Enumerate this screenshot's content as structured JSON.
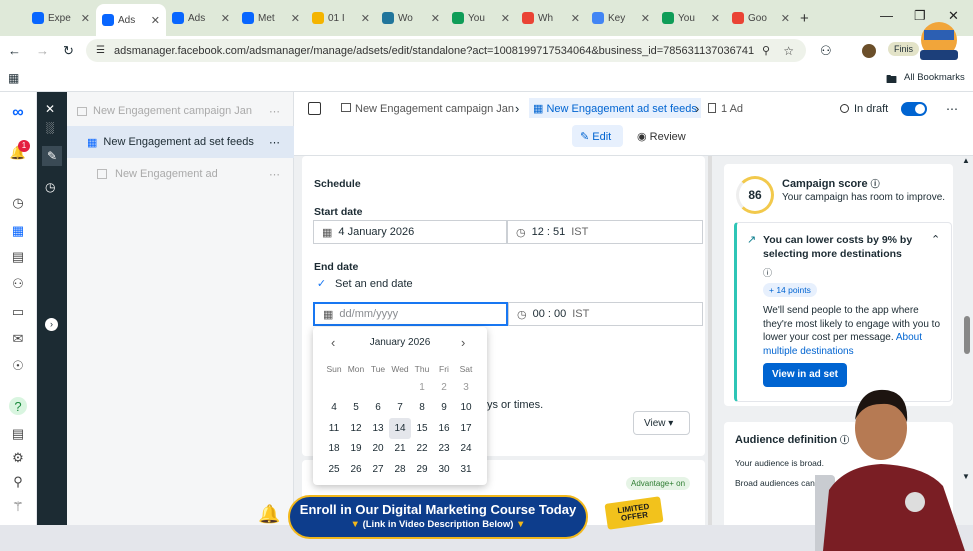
{
  "browser": {
    "tabs": [
      {
        "label": "Expe",
        "icon": "meta-icon"
      },
      {
        "label": "Ads",
        "icon": "meta-icon",
        "active": true
      },
      {
        "label": "Ads",
        "icon": "meta-icon"
      },
      {
        "label": "Met",
        "icon": "meta-icon"
      },
      {
        "label": "01 I",
        "icon": "drive-icon"
      },
      {
        "label": "Wo",
        "icon": "wordpress-icon"
      },
      {
        "label": "You",
        "icon": "sheets-icon"
      },
      {
        "label": "Wh",
        "icon": "google-icon"
      },
      {
        "label": "Key",
        "icon": "ads-icon"
      },
      {
        "label": "You",
        "icon": "sheets-icon"
      },
      {
        "label": "Goo",
        "icon": "google-icon"
      }
    ],
    "new_tab": "+",
    "url": "adsmanager.facebook.com/adsmanager/manage/adsets/edit/standalone?act=1008199717534064&business_id=785631137036741...",
    "profile_label": "Finis",
    "all_bookmarks": "All Bookmarks"
  },
  "notification_count": "1",
  "tree": {
    "campaign": "New Engagement campaign Jan",
    "adset": "New Engagement ad set feeds",
    "ad": "New Engagement ad"
  },
  "breadcrumb": {
    "campaign": "New Engagement campaign Jan",
    "adset": "New Engagement ad set feeds",
    "ad": "1 Ad",
    "status": "In draft"
  },
  "modes": {
    "edit": "Edit",
    "review": "Review"
  },
  "schedule": {
    "heading": "Schedule",
    "start_label": "Start date",
    "start_date": "4 January 2026",
    "start_time": "12 : 51",
    "tz": "IST",
    "end_label": "End date",
    "set_end": "Set an end date",
    "end_placeholder": "dd/mm/yyyy",
    "end_time": "00 : 00",
    "behind_text": "ys or times.",
    "view_btn": "View"
  },
  "calendar": {
    "month": "January 2026",
    "days": [
      "Sun",
      "Mon",
      "Tue",
      "Wed",
      "Thu",
      "Fri",
      "Sat"
    ],
    "weeks": [
      [
        "",
        "",
        "",
        "",
        "1",
        "2",
        "3"
      ],
      [
        "4",
        "5",
        "6",
        "7",
        "8",
        "9",
        "10"
      ],
      [
        "11",
        "12",
        "13",
        "14",
        "15",
        "16",
        "17"
      ],
      [
        "18",
        "19",
        "20",
        "21",
        "22",
        "23",
        "24"
      ],
      [
        "25",
        "26",
        "27",
        "28",
        "29",
        "30",
        "31"
      ]
    ],
    "hovered": "14"
  },
  "score": {
    "value": "86",
    "title": "Campaign score",
    "subtitle": "Your campaign has room to improve.",
    "tip_title": "You can lower costs by 9% by selecting more destinations",
    "points": "+ 14 points",
    "body": "We'll send people to the app where they're most likely to engage with you to lower your cost per message.",
    "link": "About multiple destinations",
    "button": "View in ad set"
  },
  "audience": {
    "title": "Audience definition",
    "line1": "Your audience is broad.",
    "line2": "Broad audiences can i"
  },
  "advantage_badge": "Advantage+ on",
  "promo": {
    "title": "Enroll in Our Digital Marketing Course Today",
    "sub": "(Link in Video Description Below)",
    "offer": "LIMITED OFFER"
  },
  "colors": {
    "accent": "#0064d1",
    "dark_rail": "#1c2b33",
    "score_ring": "#f2c94c"
  }
}
